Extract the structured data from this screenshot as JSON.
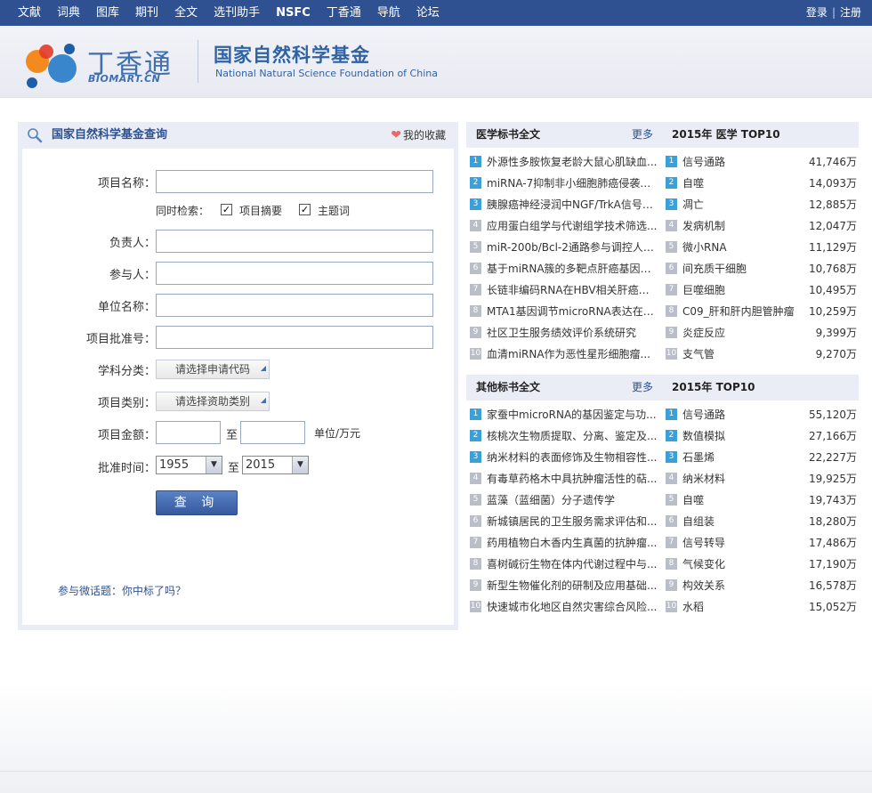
{
  "nav": {
    "links": [
      {
        "label": "文献",
        "bold": false
      },
      {
        "label": "词典",
        "bold": false
      },
      {
        "label": "图库",
        "bold": false
      },
      {
        "label": "期刊",
        "bold": false
      },
      {
        "label": "全文",
        "bold": false
      },
      {
        "label": "选刊助手",
        "bold": false
      },
      {
        "label": "NSFC",
        "bold": true
      },
      {
        "label": "丁香通",
        "bold": false
      },
      {
        "label": "导航",
        "bold": false
      },
      {
        "label": "论坛",
        "bold": false
      }
    ],
    "login": "登录",
    "separator": "|",
    "register": "注册"
  },
  "header": {
    "logo_cn": "丁香通",
    "logo_en": "BIOMART.CN",
    "nsfc_cn": "国家自然科学基金",
    "nsfc_en": "National Natural Science Foundation of China",
    "logo_colors": [
      "#f28a1e",
      "#e33a2a",
      "#3a86cc",
      "#1c5fa8"
    ]
  },
  "search_panel": {
    "title": "国家自然科学基金查询",
    "favorites": "我的收藏",
    "labels": {
      "project_name": "项目名称：",
      "also_search": "同时检索：",
      "abstract": "项目摘要",
      "keywords": "主题词",
      "leader": "负责人：",
      "participant": "参与人：",
      "institution": "单位名称：",
      "approval_no": "项目批准号：",
      "subject": "学科分类：",
      "category": "项目类别：",
      "amount": "项目金额：",
      "to": "至",
      "unit": "单位/万元",
      "approval_time": "批准时间：",
      "to2": "至"
    },
    "checkbox_mark": "✓",
    "subject_picker": "请选择申请代码",
    "category_picker": "请选择资助类别",
    "year_from": "1955",
    "year_to": "2015",
    "query_button": "查 询",
    "weibo_link": "参与微话题：你中标了吗？"
  },
  "medical": {
    "title": "医学标书全文",
    "more": "更多",
    "top_title": "2015年 医学 TOP10",
    "items": [
      {
        "n": "1",
        "title": "外源性多胺恢复老龄大鼠心肌缺血...",
        "kw": "信号通路",
        "count": "41,746万"
      },
      {
        "n": "2",
        "title": "miRNA-7抑制非小细胞肺癌侵袭转...",
        "kw": "自噬",
        "count": "14,093万"
      },
      {
        "n": "3",
        "title": "胰腺癌神经浸润中NGF/TrkA信号通...",
        "kw": "凋亡",
        "count": "12,885万"
      },
      {
        "n": "4",
        "title": "应用蛋白组学与代谢组学技术筛选...",
        "kw": "发病机制",
        "count": "12,047万"
      },
      {
        "n": "5",
        "title": "miR-200b/Bcl-2通路参与调控人肺...",
        "kw": "微小RNA",
        "count": "11,129万"
      },
      {
        "n": "6",
        "title": "基于miRNA簇的多靶点肝癌基因治...",
        "kw": "间充质干细胞",
        "count": "10,768万"
      },
      {
        "n": "7",
        "title": "长链非编码RNA在HBV相关肝癌发...",
        "kw": "巨噬细胞",
        "count": "10,495万"
      },
      {
        "n": "8",
        "title": "MTA1基因调节microRNA表达在肺...",
        "kw": "C09_肝和肝内胆管肿瘤",
        "count": "10,259万"
      },
      {
        "n": "9",
        "title": "社区卫生服务绩效评价系统研究",
        "kw": "炎症反应",
        "count": "9,399万"
      },
      {
        "n": "10",
        "title": "血清miRNA作为恶性星形细胞瘤...",
        "kw": "支气管",
        "count": "9,270万"
      }
    ]
  },
  "other": {
    "title": "其他标书全文",
    "more": "更多",
    "top_title": "2015年 TOP10",
    "items": [
      {
        "n": "1",
        "title": "家蚕中microRNA的基因鉴定与功...",
        "kw": "信号通路",
        "count": "55,120万"
      },
      {
        "n": "2",
        "title": "核桃次生物质提取、分离、鉴定及...",
        "kw": "数值模拟",
        "count": "27,166万"
      },
      {
        "n": "3",
        "title": "纳米材料的表面修饰及生物相容性...",
        "kw": "石墨烯",
        "count": "22,227万"
      },
      {
        "n": "4",
        "title": "有毒草药格木中具抗肿瘤活性的萜...",
        "kw": "纳米材料",
        "count": "19,925万"
      },
      {
        "n": "5",
        "title": "蓝藻（蓝细菌）分子遗传学",
        "kw": "自噬",
        "count": "19,743万"
      },
      {
        "n": "6",
        "title": "新城镇居民的卫生服务需求评估和...",
        "kw": "自组装",
        "count": "18,280万"
      },
      {
        "n": "7",
        "title": "药用植物白木香内生真菌的抗肿瘤...",
        "kw": "信号转导",
        "count": "17,486万"
      },
      {
        "n": "8",
        "title": "喜树碱衍生物在体内代谢过程中与...",
        "kw": "气候变化",
        "count": "17,190万"
      },
      {
        "n": "9",
        "title": "新型生物催化剂的研制及应用基础...",
        "kw": "构效关系",
        "count": "16,578万"
      },
      {
        "n": "10",
        "title": "快速城市化地区自然灾害综合风险...",
        "kw": "水稻",
        "count": "15,052万"
      }
    ]
  },
  "colors": {
    "nav_bg": "#2f5191",
    "accent": "#2f5191",
    "rank_top": "#3aa0d9",
    "rank_rest": "#b9bec8"
  }
}
